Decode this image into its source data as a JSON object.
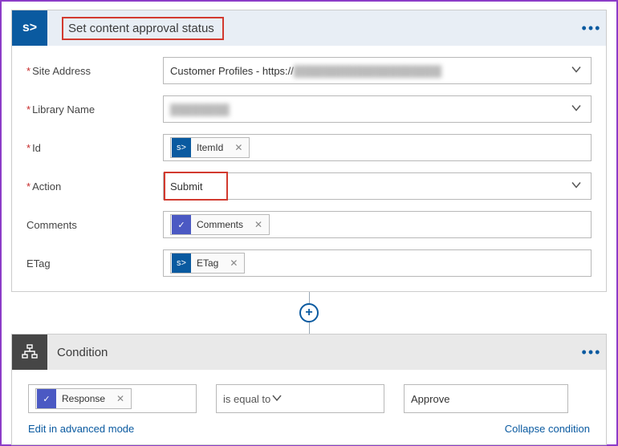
{
  "action1": {
    "title": "Set content approval status",
    "fields": {
      "siteAddress": {
        "label": "Site Address",
        "value": "Customer Profiles - https://"
      },
      "libraryName": {
        "label": "Library Name",
        "value": "████████"
      },
      "id": {
        "label": "Id",
        "chip": "ItemId"
      },
      "action": {
        "label": "Action",
        "value": "Submit"
      },
      "comments": {
        "label": "Comments",
        "chip": "Comments"
      },
      "etag": {
        "label": "ETag",
        "chip": "ETag"
      }
    }
  },
  "condition": {
    "title": "Condition",
    "left_chip": "Response",
    "operator": "is equal to",
    "right_value": "Approve",
    "edit_link": "Edit in advanced mode",
    "collapse_link": "Collapse condition"
  }
}
